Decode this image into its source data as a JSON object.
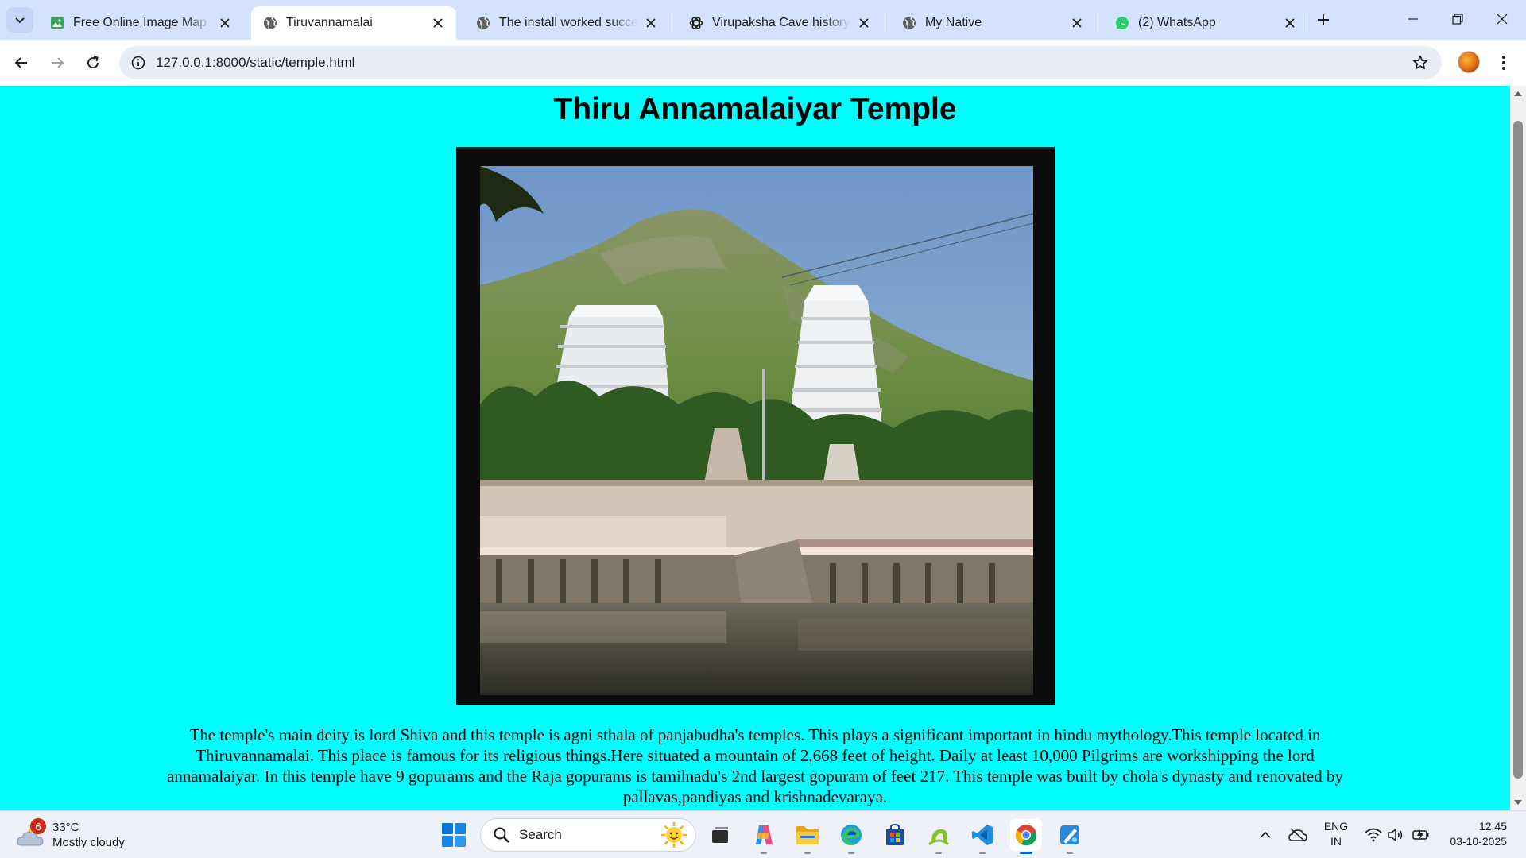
{
  "browser": {
    "tabs": [
      {
        "title": "Free Online Image Map Generator",
        "favicon": "image-map-icon",
        "active": false
      },
      {
        "title": "Tiruvannamalai",
        "favicon": "globe-icon",
        "active": true
      },
      {
        "title": "The install worked successfully!",
        "favicon": "globe-icon",
        "active": false
      },
      {
        "title": "Virupaksha Cave history",
        "favicon": "openai-icon",
        "active": false
      },
      {
        "title": "My Native",
        "favicon": "globe-icon",
        "active": false
      },
      {
        "title": "(2) WhatsApp",
        "favicon": "whatsapp-icon",
        "active": false
      }
    ],
    "url": "127.0.0.1:8000/static/temple.html"
  },
  "page": {
    "title": "Thiru Annamalaiyar Temple",
    "description": "The temple's main deity is lord Shiva and this temple is agni sthala of panjabudha's temples. This plays a significant important in hindu mythology.This temple located in Thiruvannamalai. This place is famous for its religious things.Here situated a mountain of 2,668 feet of height. Daily at least 10,000 Pilgrims are workshipping the lord annamalaiyar. In this temple have 9 gopurams and the Raja gopurams is tamilnadu's 2nd largest gopuram of feet 217. This temple was built by chola's dynasty and renovated by pallavas,pandiyas and krishnadevaraya."
  },
  "taskbar": {
    "weather": {
      "badge": "6",
      "temp": "33°C",
      "condition": "Mostly cloudy"
    },
    "search_placeholder": "Search",
    "apps": [
      "task-view",
      "copilot",
      "file-explorer",
      "edge",
      "microsoft-store",
      "android-studio",
      "vs-code",
      "chrome",
      "paint-app"
    ],
    "language": {
      "line1": "ENG",
      "line2": "IN"
    },
    "clock": {
      "time": "12:45",
      "date": "03-10-2025"
    }
  },
  "colors": {
    "page_background": "#00ffff",
    "tabstrip": "#d3e3fd",
    "frame": "#0c0c0c"
  }
}
